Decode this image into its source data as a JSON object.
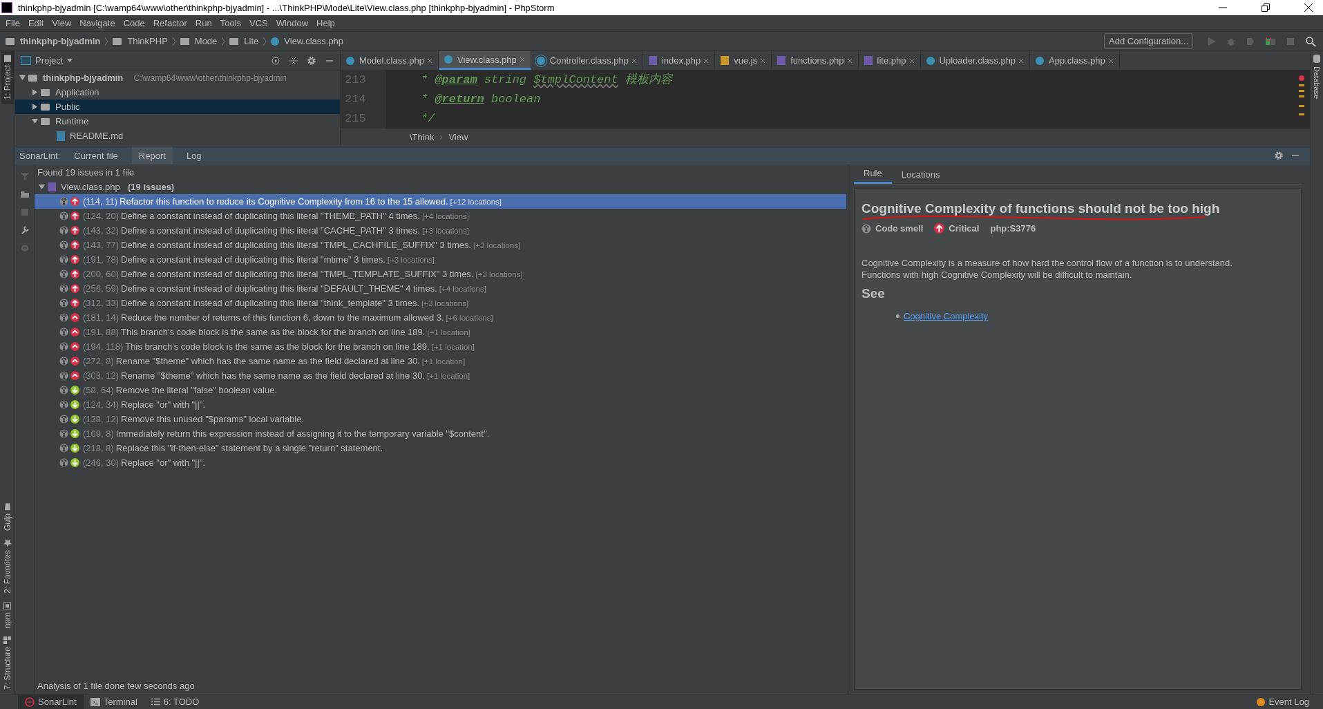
{
  "window": {
    "title": "thinkphp-bjyadmin [C:\\wamp64\\www\\other\\thinkphp-bjyadmin] - ...\\ThinkPHP\\Mode\\Lite\\View.class.php [thinkphp-bjyadmin] - PhpStorm"
  },
  "menu": [
    "File",
    "Edit",
    "View",
    "Navigate",
    "Code",
    "Refactor",
    "Run",
    "Tools",
    "VCS",
    "Window",
    "Help"
  ],
  "breadcrumb": [
    {
      "label": "thinkphp-bjyadmin",
      "bold": true,
      "kind": "folder"
    },
    {
      "label": "ThinkPHP",
      "bold": false,
      "kind": "folder"
    },
    {
      "label": "Mode",
      "bold": false,
      "kind": "folder"
    },
    {
      "label": "Lite",
      "bold": false,
      "kind": "folder"
    },
    {
      "label": "View.class.php",
      "bold": false,
      "kind": "class"
    }
  ],
  "run_config": {
    "label": "Add Configuration..."
  },
  "left_tools_top": [
    {
      "label": "1: Project",
      "selected": true
    }
  ],
  "left_tools_bottom": [
    {
      "label": "Gulp",
      "selected": false,
      "kind": "cup"
    },
    {
      "label": "2: Favorites",
      "selected": false,
      "kind": "star"
    },
    {
      "label": "npm",
      "selected": false,
      "kind": "box"
    },
    {
      "label": "7: Structure",
      "selected": false,
      "kind": "blocks"
    }
  ],
  "right_tools": [
    "Database"
  ],
  "project": {
    "title": "Project",
    "tree": [
      {
        "label": "thinkphp-bjyadmin",
        "path": "C:\\wamp64\\www\\other\\thinkphp-bjyadmin",
        "kind": "folder",
        "expanded": true,
        "selected": false,
        "children": [
          {
            "label": "Application",
            "kind": "folder",
            "expanded": false,
            "selected": false
          },
          {
            "label": "Public",
            "kind": "folder",
            "expanded": false,
            "selected": true
          },
          {
            "label": "Runtime",
            "kind": "folder",
            "expanded": true,
            "selected": false,
            "children": [
              {
                "label": "README.md",
                "kind": "md",
                "selected": false
              }
            ]
          }
        ]
      }
    ]
  },
  "editor": {
    "tabs": [
      {
        "label": "Model.class.php",
        "kind": "class",
        "selected": false
      },
      {
        "label": "View.class.php",
        "kind": "class",
        "selected": true
      },
      {
        "label": "Controller.class.php",
        "kind": "abstract",
        "selected": false
      },
      {
        "label": "index.php",
        "kind": "php",
        "selected": false
      },
      {
        "label": "vue.js",
        "kind": "js",
        "selected": false
      },
      {
        "label": "functions.php",
        "kind": "php",
        "selected": false
      },
      {
        "label": "lite.php",
        "kind": "php",
        "selected": false
      },
      {
        "label": "Uploader.class.php",
        "kind": "class",
        "selected": false
      },
      {
        "label": "App.class.php",
        "kind": "class",
        "selected": false
      }
    ],
    "lines": [
      {
        "number": "213",
        "tokens": [
          {
            "kind": "comment",
            "text": "* "
          },
          {
            "kind": "tag",
            "text": "@param"
          },
          {
            "kind": "comment",
            "text": " string "
          },
          {
            "kind": "var",
            "text": "$tmplContent"
          },
          {
            "kind": "comment",
            "text": "  模板内容"
          }
        ]
      },
      {
        "number": "214",
        "tokens": [
          {
            "kind": "comment",
            "text": "* "
          },
          {
            "kind": "tag",
            "text": "@return"
          },
          {
            "kind": "comment",
            "text": " boolean"
          }
        ]
      },
      {
        "number": "215",
        "tokens": [
          {
            "kind": "comment",
            "text": "*/"
          }
        ]
      }
    ],
    "crumbs": [
      "\\Think",
      "View"
    ]
  },
  "sonarlint": {
    "label": "SonarLint:",
    "tabs": [
      {
        "label": "Current file",
        "selected": false
      },
      {
        "label": "Report",
        "selected": true
      },
      {
        "label": "Log",
        "selected": false
      }
    ],
    "summary": "Found 19 issues in 1 file",
    "file": {
      "label": "View.class.php",
      "count": "(19 issues)",
      "expanded": true
    },
    "issues": [
      {
        "location": "(114, 11)",
        "message": "Refactor this function to reduce its Cognitive Complexity from 16 to the 15 allowed.",
        "extra": "[+12 locations]",
        "kind": "critical",
        "selected": true
      },
      {
        "location": "(124, 20)",
        "message": "Define a constant instead of duplicating this literal \"THEME_PATH\" 4 times.",
        "extra": "[+4 locations]",
        "kind": "critical",
        "selected": false
      },
      {
        "location": "(143, 32)",
        "message": "Define a constant instead of duplicating this literal \"CACHE_PATH\" 3 times.",
        "extra": "[+3 locations]",
        "kind": "critical",
        "selected": false
      },
      {
        "location": "(143, 77)",
        "message": "Define a constant instead of duplicating this literal \"TMPL_CACHFILE_SUFFIX\" 3 times.",
        "extra": "[+3 locations]",
        "kind": "critical",
        "selected": false
      },
      {
        "location": "(191, 78)",
        "message": "Define a constant instead of duplicating this literal \"mtime\" 3 times.",
        "extra": "[+3 locations]",
        "kind": "critical",
        "selected": false
      },
      {
        "location": "(200, 60)",
        "message": "Define a constant instead of duplicating this literal \"TMPL_TEMPLATE_SUFFIX\" 3 times.",
        "extra": "[+3 locations]",
        "kind": "critical",
        "selected": false
      },
      {
        "location": "(256, 59)",
        "message": "Define a constant instead of duplicating this literal \"DEFAULT_THEME\" 4 times.",
        "extra": "[+4 locations]",
        "kind": "critical",
        "selected": false
      },
      {
        "location": "(312, 33)",
        "message": "Define a constant instead of duplicating this literal \"think_template\" 3 times.",
        "extra": "[+3 locations]",
        "kind": "critical",
        "selected": false
      },
      {
        "location": "(181, 14)",
        "message": "Reduce the number of returns of this function 6, down to the maximum allowed 3.",
        "extra": "[+6 locations]",
        "kind": "major",
        "selected": false
      },
      {
        "location": "(191, 88)",
        "message": "This branch's code block is the same as the block for the branch on line 189.",
        "extra": "[+1 location]",
        "kind": "major",
        "selected": false
      },
      {
        "location": "(194, 118)",
        "message": "This branch's code block is the same as the block for the branch on line 189.",
        "extra": "[+1 location]",
        "kind": "major",
        "selected": false
      },
      {
        "location": "(272, 8)",
        "message": "Rename \"$theme\" which has the same name as the field declared at line 30.",
        "extra": "[+1 location]",
        "kind": "major",
        "selected": false
      },
      {
        "location": "(303, 12)",
        "message": "Rename \"$theme\" which has the same name as the field declared at line 30.",
        "extra": "[+1 location]",
        "kind": "major",
        "selected": false
      },
      {
        "location": "(58, 64)",
        "message": "Remove the literal \"false\" boolean value.",
        "kind": "minor",
        "selected": false
      },
      {
        "location": "(124, 34)",
        "message": "Replace \"or\" with \"||\".",
        "kind": "minor",
        "selected": false
      },
      {
        "location": "(138, 12)",
        "message": "Remove this unused \"$params\" local variable.",
        "kind": "minor",
        "selected": false
      },
      {
        "location": "(169, 8)",
        "message": "Immediately return this expression instead of assigning it to the temporary variable \"$content\".",
        "kind": "minor",
        "selected": false
      },
      {
        "location": "(218, 8)",
        "message": "Replace this \"if-then-else\" statement by a single \"return\" statement.",
        "kind": "minor",
        "selected": false
      },
      {
        "location": "(246, 30)",
        "message": "Replace \"or\" with \"||\".",
        "kind": "minor",
        "selected": false
      }
    ],
    "status": "Analysis of 1 file done few seconds ago",
    "detail_tabs": [
      {
        "label": "Rule",
        "selected": true
      },
      {
        "label": "Locations",
        "selected": false
      }
    ],
    "rule": {
      "title": "Cognitive Complexity of functions should not be too high",
      "type": "Code smell",
      "severity": {
        "label": "Critical",
        "kind": "critical"
      },
      "key": "php:S3776",
      "description": [
        "Cognitive Complexity is a measure of how hard the control flow of a function is to understand.",
        "Functions with high Cognitive Complexity will be difficult to maintain."
      ],
      "see_heading": "See",
      "links": [
        "Cognitive Complexity"
      ]
    }
  },
  "bottom_tabs": [
    {
      "label": "SonarLint",
      "kind": "sonar",
      "selected": true
    },
    {
      "label": "Terminal",
      "kind": "terminal",
      "selected": false
    },
    {
      "label": "6: TODO",
      "kind": "list",
      "selected": false
    }
  ],
  "event_log": {
    "label": "Event Log"
  }
}
